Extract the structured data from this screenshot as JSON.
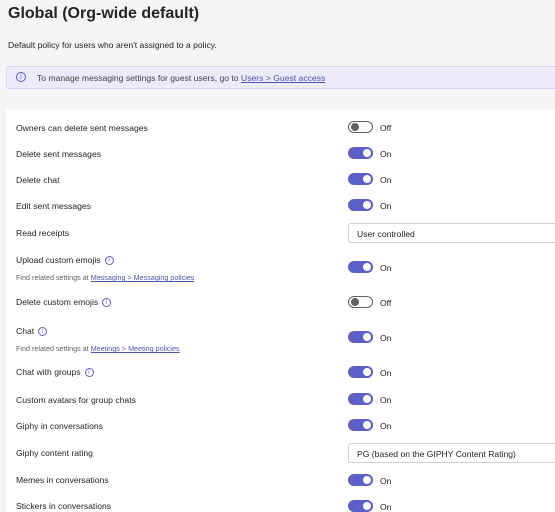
{
  "page": {
    "title": "Global (Org-wide default)",
    "subtitle": "Default policy for users who aren't assigned to a policy."
  },
  "banner": {
    "icon": "info-icon",
    "text": "To manage messaging settings for guest users, go to ",
    "link": "Users > Guest access"
  },
  "settings": [
    {
      "label": "Owners can delete sent messages",
      "type": "toggle",
      "on": false,
      "state": "Off"
    },
    {
      "label": "Delete sent messages",
      "type": "toggle",
      "on": true,
      "state": "On"
    },
    {
      "label": "Delete chat",
      "type": "toggle",
      "on": true,
      "state": "On"
    },
    {
      "label": "Edit sent messages",
      "type": "toggle",
      "on": true,
      "state": "On"
    },
    {
      "label": "Read receipts",
      "type": "select",
      "value": "User controlled"
    },
    {
      "label": "Upload custom emojis",
      "type": "toggle",
      "on": true,
      "state": "On",
      "info": true,
      "related_prefix": "Find related settings at ",
      "related_link": "Messaging > Messaging policies"
    },
    {
      "label": "Delete custom emojis",
      "type": "toggle",
      "on": false,
      "state": "Off",
      "info": true
    },
    {
      "label": "Chat",
      "type": "toggle",
      "on": true,
      "state": "On",
      "info": true,
      "related_prefix": "Find related settings at ",
      "related_link": "Meetings > Meeting policies"
    },
    {
      "label": "Chat with groups",
      "type": "toggle",
      "on": true,
      "state": "On",
      "info": true
    },
    {
      "label": "Custom avatars for group chats",
      "type": "toggle",
      "on": true,
      "state": "On"
    },
    {
      "label": "Giphy in conversations",
      "type": "toggle",
      "on": true,
      "state": "On"
    },
    {
      "label": "Giphy content rating",
      "type": "select",
      "value": "PG (based on the GIPHY Content Rating)"
    },
    {
      "label": "Memes in conversations",
      "type": "toggle",
      "on": true,
      "state": "On"
    },
    {
      "label": "Stickers in conversations",
      "type": "toggle",
      "on": true,
      "state": "On"
    }
  ],
  "info_glyph": "i",
  "colors": {
    "accent": "#5b5fc7",
    "link": "#4f52b2",
    "banner_bg": "#ebebfb"
  }
}
